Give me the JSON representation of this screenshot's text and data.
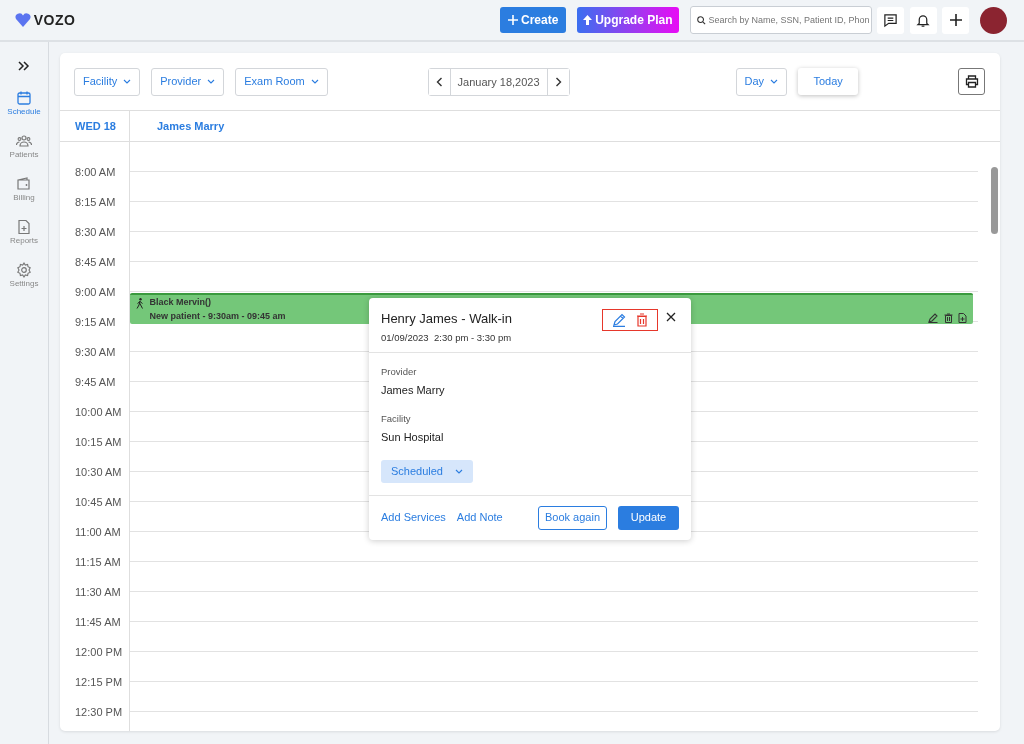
{
  "topbar": {
    "logo": "VOZO",
    "create_button": "Create",
    "upgrade_button": "Upgrade Plan",
    "search": {
      "placeholder": "Search by Name, SSN, Patient ID, Phon"
    }
  },
  "sidebar": {
    "items": [
      {
        "label": "Schedule",
        "kind": "calendar",
        "selected": true
      },
      {
        "label": "Patients",
        "kind": "people",
        "selected": false
      },
      {
        "label": "Billing",
        "kind": "wallet",
        "selected": false
      },
      {
        "label": "Reports",
        "kind": "report",
        "selected": false
      },
      {
        "label": "Settings",
        "kind": "gear",
        "selected": false
      }
    ]
  },
  "toolbar": {
    "filters": [
      "Facility",
      "Provider",
      "Exam Room"
    ],
    "date": "January 18,2023",
    "view": "Day",
    "today_button": "Today"
  },
  "header": {
    "day": "WED 18",
    "provider": "James Marry"
  },
  "times": [
    "8:00 AM",
    "8:15 AM",
    "8:30 AM",
    "8:45 AM",
    "9:00 AM",
    "9:15 AM",
    "9:30 AM",
    "9:45 AM",
    "10:00 AM",
    "10:15 AM",
    "10:30 AM",
    "10:45 AM",
    "11:00 AM",
    "11:15 AM",
    "11:30 AM",
    "11:45 AM",
    "12:00 PM",
    "12:15 PM",
    "12:30 PM"
  ],
  "event": {
    "title": "Black Mervin()",
    "detail": "New patient - 9:30am - 09:45 am",
    "color": "#74c779"
  },
  "popover": {
    "title": "Henry James - Walk-in",
    "date": "01/09/2023",
    "time": "2:30 pm - 3:30 pm",
    "actions_highlighted": true,
    "fields": [
      {
        "label": "Provider",
        "value": "James Marry"
      },
      {
        "label": "Facility",
        "value": "Sun Hospital"
      }
    ],
    "status": "Scheduled",
    "links": [
      "Add Services",
      "Add Note"
    ],
    "secondary_button": "Book again",
    "primary_button": "Update"
  }
}
